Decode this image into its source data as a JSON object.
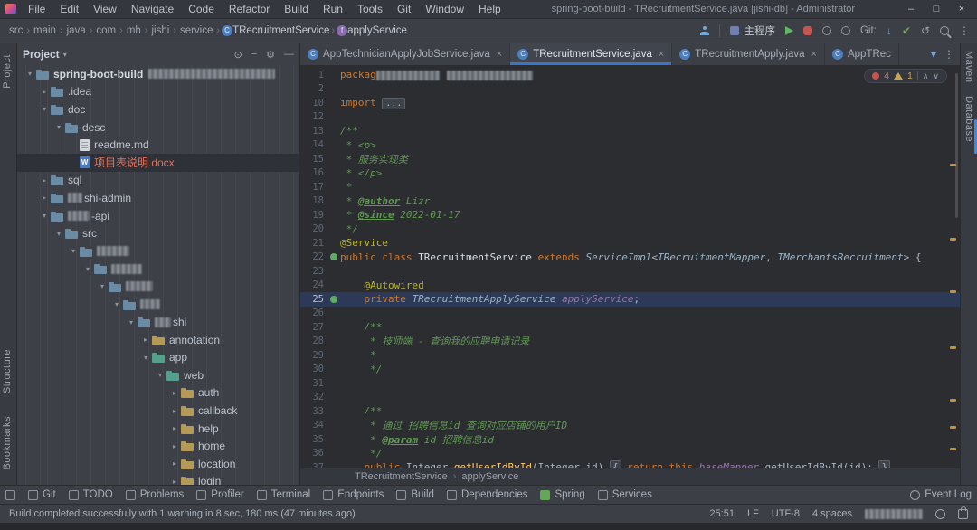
{
  "window": {
    "title": "spring-boot-build - TRecruitmentService.java [jishi-db] - Administrator",
    "controls": {
      "minimize": "–",
      "maximize": "□",
      "close": "×"
    }
  },
  "menu": {
    "items": [
      "File",
      "Edit",
      "View",
      "Navigate",
      "Code",
      "Refactor",
      "Build",
      "Run",
      "Tools",
      "Git",
      "Window",
      "Help"
    ]
  },
  "navbar": {
    "path": [
      "src",
      "main",
      "java",
      "com",
      "mh",
      "jishi",
      "service"
    ],
    "class_item": "TRecruitmentService",
    "field_item": "applyService",
    "run_config": "主程序",
    "git_label": "Git:"
  },
  "glyphs": {
    "caret_open": "▾",
    "caret_closed": "▸",
    "chevron": "›",
    "kebab": "⋮",
    "gear": "⚙",
    "target": "⊙",
    "minus": "−",
    "hide": "—",
    "close": "×",
    "arrow_down": "↓",
    "check": "✔",
    "rollback": "↺",
    "tab_chevron": "▾",
    "nav_up": "∧",
    "nav_down": "∨"
  },
  "project_panel": {
    "title": "Project",
    "tree": [
      {
        "d": 0,
        "caret": "open",
        "icon": "folder",
        "label": "spring-boot-build",
        "bold": true,
        "redact_after": 140
      },
      {
        "d": 1,
        "caret": "closed",
        "icon": "folder",
        "label": ".idea"
      },
      {
        "d": 1,
        "caret": "open",
        "icon": "folder",
        "label": "doc"
      },
      {
        "d": 2,
        "caret": "open",
        "icon": "folder",
        "label": "desc"
      },
      {
        "d": 3,
        "caret": "none",
        "icon": "file-md",
        "label": "readme.md"
      },
      {
        "d": 3,
        "caret": "none",
        "icon": "file-docx",
        "label": "项目表说明.docx",
        "selected": true,
        "status": "modified"
      },
      {
        "d": 1,
        "caret": "closed",
        "icon": "folder",
        "label": "sql"
      },
      {
        "d": 1,
        "caret": "closed",
        "icon": "folder",
        "label": "shi-admin",
        "redact_before": 16
      },
      {
        "d": 1,
        "caret": "open",
        "icon": "folder",
        "label": "-api",
        "redact_before": 24
      },
      {
        "d": 2,
        "caret": "open",
        "icon": "folder-src",
        "label": "src"
      },
      {
        "d": 3,
        "caret": "open",
        "icon": "folder",
        "label": "",
        "redact_before": 36
      },
      {
        "d": 4,
        "caret": "open",
        "icon": "folder",
        "label": "",
        "redact_before": 34
      },
      {
        "d": 5,
        "caret": "open",
        "icon": "folder",
        "label": "",
        "redact_before": 30
      },
      {
        "d": 6,
        "caret": "open",
        "icon": "folder",
        "label": "",
        "redact_before": 22
      },
      {
        "d": 7,
        "caret": "open",
        "icon": "folder",
        "label": "shi",
        "redact_before": 18
      },
      {
        "d": 8,
        "caret": "closed",
        "icon": "folder-yellow",
        "label": "annotation"
      },
      {
        "d": 8,
        "caret": "open",
        "icon": "folder-teal",
        "label": "app"
      },
      {
        "d": 9,
        "caret": "open",
        "icon": "folder-teal",
        "label": "web"
      },
      {
        "d": 10,
        "caret": "closed",
        "icon": "folder-yellow",
        "label": "auth"
      },
      {
        "d": 10,
        "caret": "closed",
        "icon": "folder-yellow",
        "label": "callback"
      },
      {
        "d": 10,
        "caret": "closed",
        "icon": "folder-yellow",
        "label": "help"
      },
      {
        "d": 10,
        "caret": "closed",
        "icon": "folder-yellow",
        "label": "home"
      },
      {
        "d": 10,
        "caret": "closed",
        "icon": "folder-yellow",
        "label": "location"
      },
      {
        "d": 10,
        "caret": "closed",
        "icon": "folder-yellow",
        "label": "login"
      }
    ]
  },
  "tabs": {
    "items": [
      {
        "label": "AppTechnicianApplyJobService.java",
        "close": true
      },
      {
        "label": "TRecruitmentService.java",
        "close": true,
        "active": true
      },
      {
        "label": "TRecruitmentApply.java",
        "close": true
      },
      {
        "label": "AppTRec",
        "close": false
      }
    ]
  },
  "editor": {
    "inspections": {
      "errors": "4",
      "warnings": "1"
    },
    "breadcrumb": [
      "TRecruitmentService",
      "applyService"
    ],
    "lines": [
      {
        "n": 1,
        "tk": [
          {
            "c": "kw",
            "t": "packag"
          },
          {
            "r": 70
          },
          {
            "s": 8
          },
          {
            "r": 95
          }
        ]
      },
      {
        "n": 2,
        "tk": []
      },
      {
        "n": 10,
        "tk": [
          {
            "c": "kw",
            "t": "import "
          },
          {
            "c": "fold",
            "t": "..."
          }
        ]
      },
      {
        "n": 12,
        "tk": []
      },
      {
        "n": 13,
        "tk": [
          {
            "c": "cm",
            "t": "/**"
          }
        ]
      },
      {
        "n": 14,
        "tk": [
          {
            "c": "cm",
            "t": " * <p>"
          }
        ]
      },
      {
        "n": 15,
        "tk": [
          {
            "c": "cm",
            "t": " * 服务实现类"
          }
        ]
      },
      {
        "n": 16,
        "tk": [
          {
            "c": "cm",
            "t": " * </p>"
          }
        ]
      },
      {
        "n": 17,
        "tk": [
          {
            "c": "cm",
            "t": " *"
          }
        ]
      },
      {
        "n": 18,
        "tk": [
          {
            "c": "cm",
            "t": " * "
          },
          {
            "c": "tag",
            "t": "@author"
          },
          {
            "c": "cm",
            "t": " Lizr"
          }
        ]
      },
      {
        "n": 19,
        "tk": [
          {
            "c": "cm",
            "t": " * "
          },
          {
            "c": "tag",
            "t": "@since"
          },
          {
            "c": "cm",
            "t": " 2022-01-17"
          }
        ]
      },
      {
        "n": 20,
        "tk": [
          {
            "c": "cm",
            "t": " */"
          }
        ]
      },
      {
        "n": 21,
        "tk": [
          {
            "c": "ann",
            "t": "@Service"
          }
        ]
      },
      {
        "n": 22,
        "bean": true,
        "tk": [
          {
            "c": "kw",
            "t": "public class "
          },
          {
            "c": "cls",
            "t": "TRecruitmentService"
          },
          {
            "c": "txt",
            "t": " "
          },
          {
            "c": "kw",
            "t": "extends "
          },
          {
            "c": "typ",
            "t": "ServiceImpl"
          },
          {
            "c": "txt",
            "t": "<"
          },
          {
            "c": "typ",
            "t": "TRecruitmentMapper"
          },
          {
            "c": "txt",
            "t": ", "
          },
          {
            "c": "typ",
            "t": "TMerchantsRecruitment"
          },
          {
            "c": "txt",
            "t": "> {"
          }
        ]
      },
      {
        "n": 23,
        "tk": []
      },
      {
        "n": 24,
        "tk": [
          {
            "c": "txt",
            "t": "    "
          },
          {
            "c": "ann",
            "t": "@Autowired"
          }
        ]
      },
      {
        "n": 25,
        "hl": true,
        "bean": true,
        "tk": [
          {
            "c": "txt",
            "t": "    "
          },
          {
            "c": "kw",
            "t": "private "
          },
          {
            "c": "typ",
            "t": "TRecruitmentApplyService "
          },
          {
            "c": "fld",
            "t": "applyService"
          },
          {
            "c": "txt",
            "t": ";"
          }
        ]
      },
      {
        "n": 26,
        "tk": []
      },
      {
        "n": 27,
        "tk": [
          {
            "c": "cm",
            "t": "    /**"
          }
        ]
      },
      {
        "n": 28,
        "tk": [
          {
            "c": "cm",
            "t": "     * 技师端 - 查询我的应聘申请记录"
          }
        ]
      },
      {
        "n": 29,
        "tk": [
          {
            "c": "cm",
            "t": "     *"
          }
        ]
      },
      {
        "n": 30,
        "tk": [
          {
            "c": "cm",
            "t": "     */"
          }
        ]
      },
      {
        "n": 31,
        "tk": []
      },
      {
        "n": 32,
        "tk": []
      },
      {
        "n": 33,
        "tk": [
          {
            "c": "cm",
            "t": "    /**"
          }
        ]
      },
      {
        "n": 34,
        "tk": [
          {
            "c": "cm",
            "t": "     * 通过 招聘信息id 查询对应店铺的用户ID"
          }
        ]
      },
      {
        "n": 35,
        "tk": [
          {
            "c": "cm",
            "t": "     * "
          },
          {
            "c": "tag",
            "t": "@param"
          },
          {
            "c": "cm",
            "t": " id 招聘信息id"
          }
        ]
      },
      {
        "n": 36,
        "tk": [
          {
            "c": "cm",
            "t": "     */"
          }
        ]
      },
      {
        "n": 37,
        "tk": [
          {
            "c": "txt",
            "t": "    "
          },
          {
            "c": "kw",
            "t": "public "
          },
          {
            "c": "txt",
            "t": "Integer "
          },
          {
            "c": "mth",
            "t": "getUserIdById"
          },
          {
            "c": "txt",
            "t": "("
          },
          {
            "c": "txt",
            "t": "Integer "
          },
          {
            "c": "txt",
            "t": "id"
          },
          {
            "c": "txt",
            "t": ") "
          },
          {
            "c": "brace",
            "t": "{"
          },
          {
            "c": "txt",
            "t": " "
          },
          {
            "c": "kw",
            "t": "return "
          },
          {
            "c": "kw",
            "t": "this"
          },
          {
            "c": "txt",
            "t": "."
          },
          {
            "c": "fld",
            "t": "baseMapper"
          },
          {
            "c": "txt",
            "t": ".getUserIdById("
          },
          {
            "c": "txt",
            "t": "id"
          },
          {
            "c": "txt",
            "t": "); "
          },
          {
            "c": "brace",
            "t": "}"
          }
        ]
      }
    ]
  },
  "tool_strips": {
    "left": [
      "Project",
      "Structure",
      "Bookmarks"
    ],
    "right": [
      "Maven",
      "Database"
    ]
  },
  "bottom_bar": {
    "items": [
      "Git",
      "TODO",
      "Problems",
      "Profiler",
      "Terminal",
      "Endpoints",
      "Build",
      "Dependencies",
      "Spring",
      "Services"
    ],
    "right": "Event Log"
  },
  "status_bar": {
    "message": "Build completed successfully with 1 warning in 8 sec, 180 ms (47 minutes ago)",
    "position": "25:51",
    "line_separator": "LF",
    "encoding": "UTF-8",
    "indent": "4 spaces"
  },
  "colors": {
    "accent_blue": "#3876c8",
    "error_red": "#c75450",
    "warning_yellow": "#c8a356",
    "run_green": "#5fb865",
    "modified_orange": "#e0705c"
  }
}
